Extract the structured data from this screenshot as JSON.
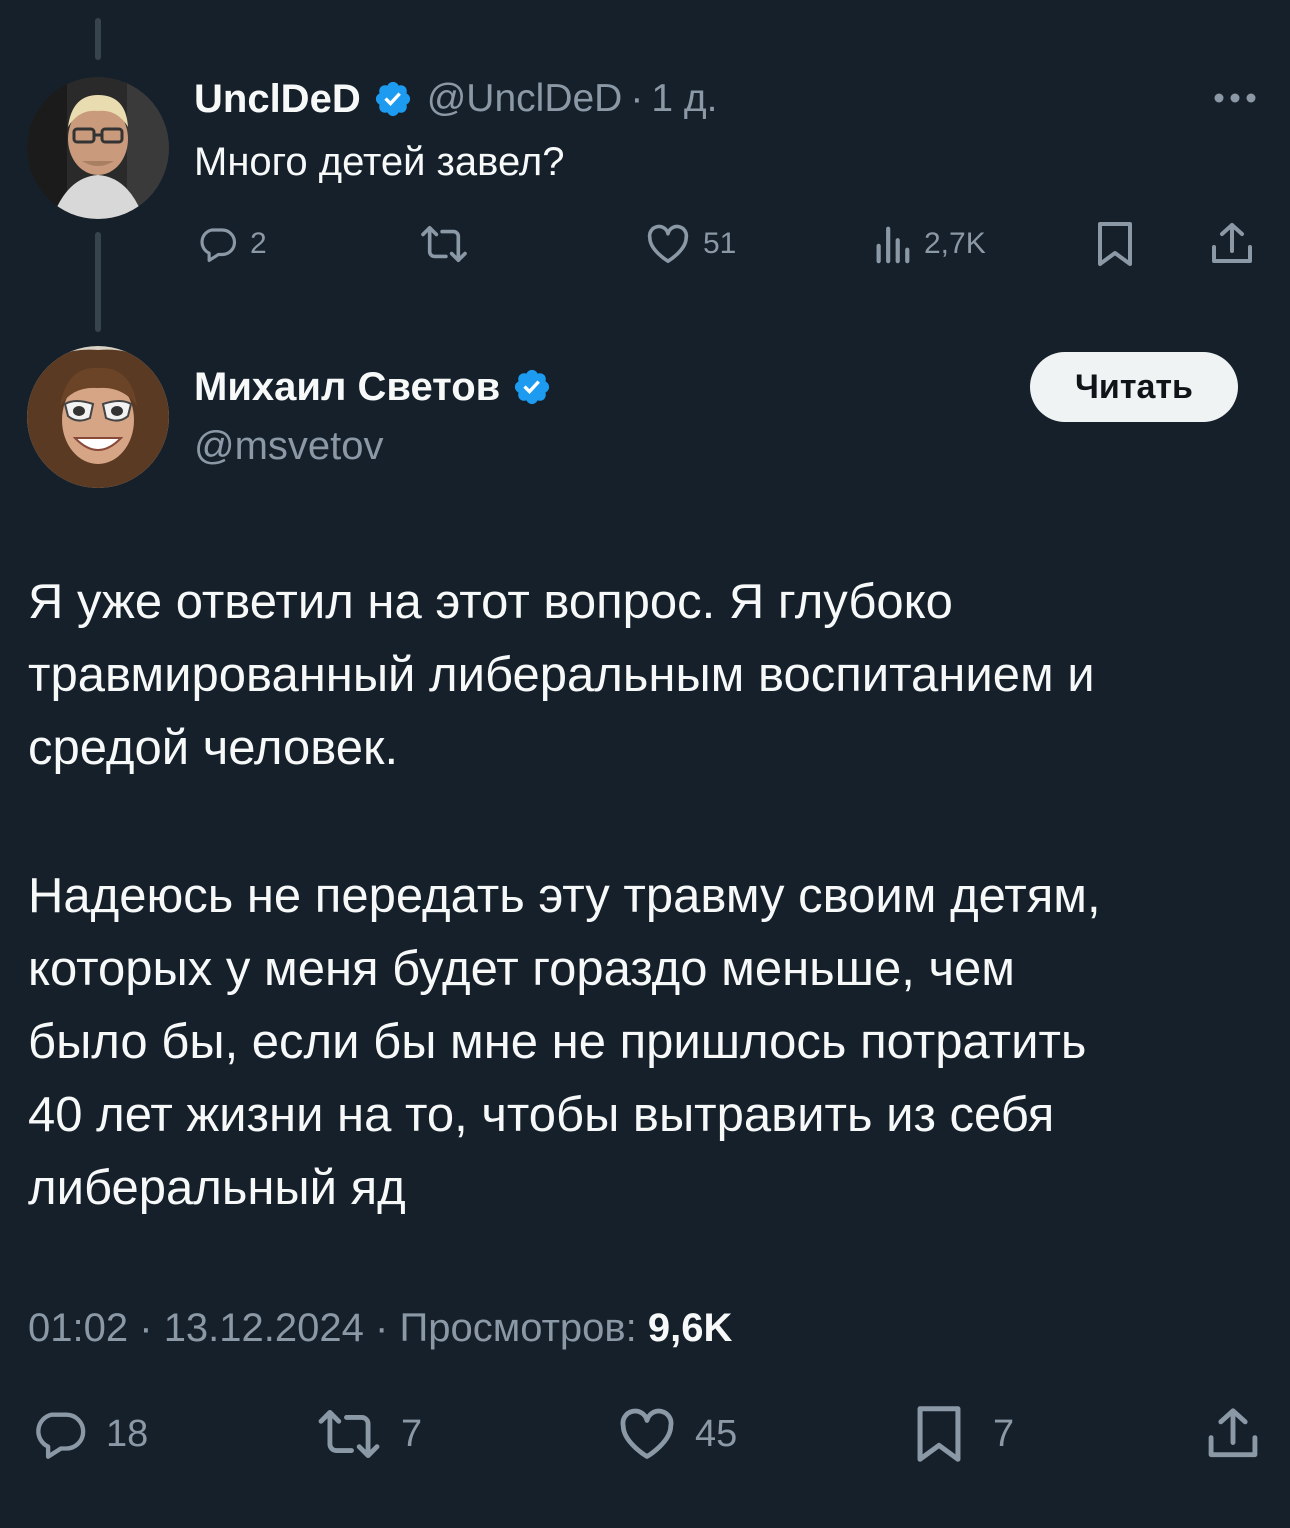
{
  "parent_tweet": {
    "name": "UnclDeD",
    "handle": "@UnclDeD",
    "separator": "·",
    "time": "1 д.",
    "text": "Много детей завел?",
    "replies": "2",
    "likes": "51",
    "views": "2,7K"
  },
  "main_tweet": {
    "name": "Михаил Светов",
    "handle": "@msvetov",
    "follow_label": "Читать",
    "paragraph1": [
      "Я уже ответил на этот вопрос. Я глубоко",
      "травмированный либеральным воспитанием и",
      "средой человек."
    ],
    "paragraph2": [
      "Надеюсь не передать эту травму своим детям,",
      "которых у меня будет гораздо меньше, чем",
      "было бы, если бы мне не пришлось потратить",
      "40 лет жизни на то, чтобы вытравить из себя",
      "либеральный яд"
    ],
    "time": "01:02",
    "date": "13.12.2024",
    "sep": "·",
    "views_label": "Просмотров:",
    "views_value": "9,6K",
    "replies": "18",
    "retweets": "7",
    "likes": "45",
    "bookmarks": "7"
  },
  "icons": [
    "more-icon",
    "verified-icon",
    "reply-icon",
    "retweet-icon",
    "like-icon",
    "views-icon",
    "bookmark-icon",
    "share-icon"
  ],
  "colors": {
    "background": "#15202b",
    "text": "#f7f9f9",
    "muted": "#8b98a5",
    "verified": "#1d9bf0",
    "button": "#eff3f4"
  }
}
